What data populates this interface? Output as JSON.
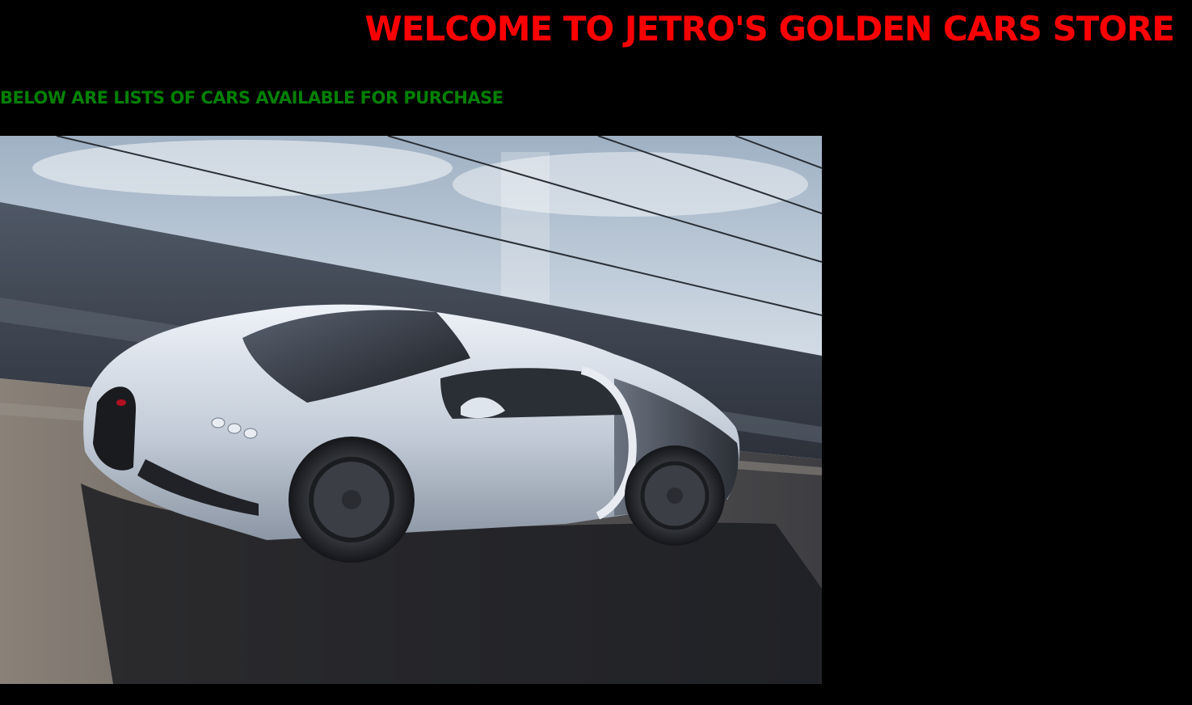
{
  "header": {
    "title": "WELCOME TO JETRO'S GOLDEN CARS STORE",
    "subtitle": "BELOW ARE LISTS OF CARS AVAILABLE FOR PURCHASE"
  },
  "colors": {
    "background": "#000000",
    "title": "#ff0000",
    "subtitle": "#008000"
  },
  "images": [
    {
      "subject": "silver sports car on a track",
      "icon": "car-photo"
    }
  ]
}
